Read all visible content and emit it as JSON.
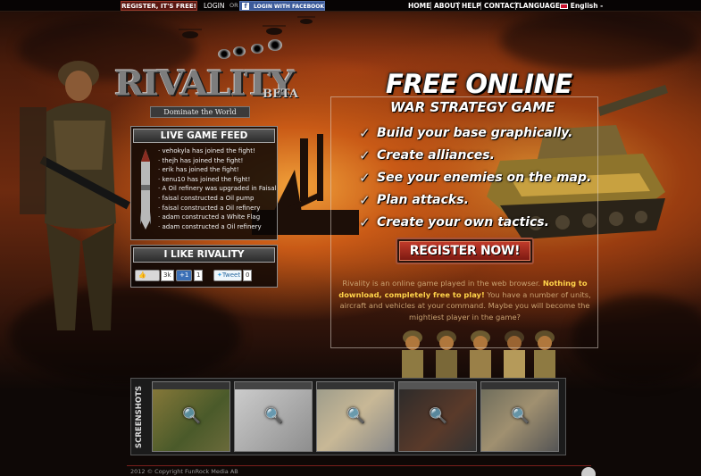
{
  "topbar": {
    "register_label": "REGISTER, IT'S FREE!",
    "login_label": "LOGIN",
    "or_label": "OR",
    "facebook_label": "LOGIN WITH FACEBOOK",
    "nav": [
      "HOME",
      "ABOUT",
      "HELP",
      "CONTACT"
    ],
    "language_label": "LANGUAGE:",
    "language_value": "English -"
  },
  "logo": {
    "name": "RIVALITY",
    "badge": "BETA",
    "tagline": "Dominate the World"
  },
  "feed": {
    "title": "LIVE GAME FEED",
    "items": [
      "vehokyla has joined the fight!",
      "thejh has joined the fight!",
      "erik has joined the fight!",
      "kenu10 has joined the fight!",
      "A Oil refinery was upgraded in Faisal",
      "faisal constructed a Oil pump",
      "faisal constructed a Oil refinery",
      "adam constructed a White Flag",
      "adam constructed a Oil refinery"
    ]
  },
  "like": {
    "title": "I LIKE RIVALITY",
    "like_count": "3k",
    "plus_label": "+1",
    "plus_count": "1",
    "tweet_label": "Tweet",
    "tweet_count": "0"
  },
  "promo": {
    "headline": "FREE ONLINE",
    "subheadline": "WAR STRATEGY GAME",
    "features": [
      "Build your base graphically.",
      "Create alliances.",
      "See your enemies on the map.",
      "Plan attacks.",
      "Create your own tactics."
    ],
    "register_now": "REGISTER NOW!",
    "desc_part1": "Rivality is an online game played in the web browser.",
    "desc_bold": "Nothing to download, completely free to play!",
    "desc_part2": "You have a number of units, aircraft and vehicles at your command. Maybe you will become the mightiest player in the game?"
  },
  "screenshots": {
    "label": "SCREENSHOTS",
    "count": 5
  },
  "footer": {
    "copyright": "2012 © Copyright FunRock Media AB"
  },
  "colors": {
    "accent_red": "#c03a2a",
    "facebook_blue": "#3b5a9a",
    "desc_highlight": "#ffd34a"
  }
}
